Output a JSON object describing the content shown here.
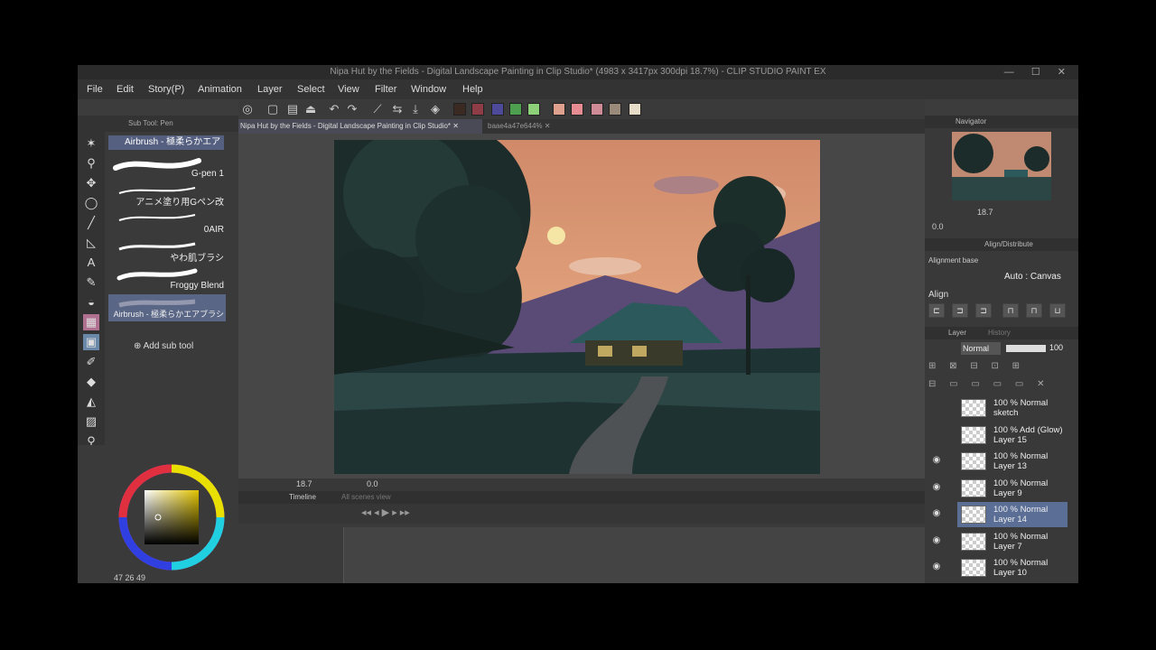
{
  "window": {
    "title": "Nipa Hut by the Fields - Digital Landscape Painting in Clip Studio* (4983 x 3417px 300dpi 18.7%) - CLIP STUDIO PAINT EX",
    "controls": "—  ☐  ✕"
  },
  "menu": [
    "File",
    "Edit",
    "Story(P)",
    "Animation",
    "Layer",
    "Select",
    "View",
    "Filter",
    "Window",
    "Help"
  ],
  "command_bar": {
    "swatches": [
      "#3a2a22",
      "#8e3c46",
      "#4e4a9a",
      "#4ea050",
      "#8ed07a",
      "#e0a08e",
      "#e88c94",
      "#d08c96",
      "#9a8a7a",
      "#e6dcc8"
    ]
  },
  "sub_tool": {
    "header": "Sub Tool: Pen",
    "active_tool": "Airbrush - 極柔らかエア",
    "brushes": [
      {
        "label": "G-pen 1"
      },
      {
        "label": "アニメ塗り用Gペン改"
      },
      {
        "label": "0AIR"
      },
      {
        "label": "やわ肌ブラシ"
      },
      {
        "label": "Froggy Blend"
      },
      {
        "label": "Airbrush - 極柔らかエアブラシ"
      }
    ],
    "add_label": "Add sub tool"
  },
  "color": {
    "main": "#807b54",
    "readout": "47  26  49",
    "square_hue": "#e0c200"
  },
  "canvas": {
    "tab_active": "Nipa Hut by the Fields - Digital Landscape Painting in Clip Studio*",
    "tab_other": "baae4a47e644%",
    "zoom": "18.7",
    "rotation": "0.0"
  },
  "timeline": {
    "tab": "Timeline",
    "tab2": "All scenes view"
  },
  "navigator": {
    "title": "Navigator",
    "zoom": "18.7",
    "rotation": "0.0"
  },
  "align": {
    "title": "Align/Distribute",
    "base_label": "Alignment base",
    "base_value": "Auto : Canvas",
    "align_label": "Align"
  },
  "layer_panel": {
    "tab": "Layer",
    "tab2": "History",
    "blend": "Normal",
    "opacity": "100",
    "layers": [
      {
        "line1": "100 % Normal",
        "line2": "sketch",
        "visible": false,
        "selected": false
      },
      {
        "line1": "100 % Add (Glow)",
        "line2": "Layer 15",
        "visible": false,
        "selected": false
      },
      {
        "line1": "100 % Normal",
        "line2": "Layer 13",
        "visible": true,
        "selected": false
      },
      {
        "line1": "100 % Normal",
        "line2": "Layer 9",
        "visible": true,
        "selected": false
      },
      {
        "line1": "100 % Normal",
        "line2": "Layer 14",
        "visible": true,
        "selected": true
      },
      {
        "line1": "100 % Normal",
        "line2": "Layer 7",
        "visible": true,
        "selected": false
      },
      {
        "line1": "100 % Normal",
        "line2": "Layer 10",
        "visible": true,
        "selected": false
      }
    ]
  }
}
